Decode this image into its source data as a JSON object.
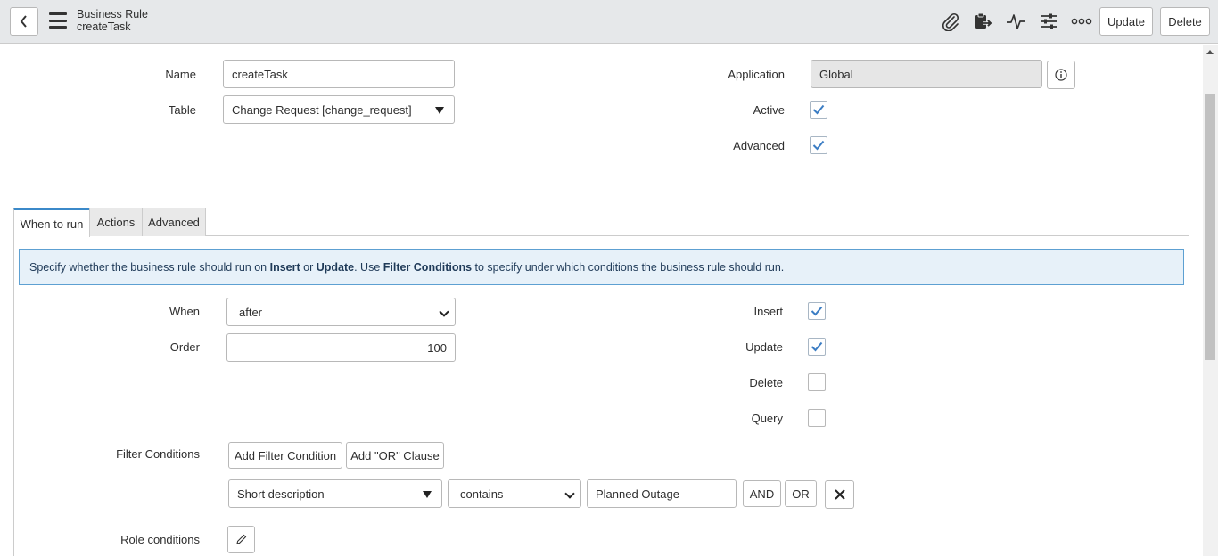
{
  "header": {
    "title": "Business Rule",
    "subtitle": "createTask",
    "icons": [
      "back-icon",
      "hamburger-icon",
      "paperclip-icon",
      "clipboard-export-icon",
      "activity-icon",
      "sliders-icon",
      "more-icon"
    ],
    "update_label": "Update",
    "delete_label": "Delete"
  },
  "form": {
    "name_label": "Name",
    "name_value": "createTask",
    "table_label": "Table",
    "table_value": "Change Request [change_request]",
    "application_label": "Application",
    "application_value": "Global",
    "active_label": "Active",
    "active_checked": true,
    "advanced_label": "Advanced",
    "advanced_checked": true
  },
  "tabs": [
    {
      "label": "When to run",
      "active": true
    },
    {
      "label": "Actions",
      "active": false
    },
    {
      "label": "Advanced",
      "active": false
    }
  ],
  "when_to_run": {
    "banner_parts": [
      "Specify whether the business rule should run on ",
      "Insert",
      " or ",
      "Update",
      ". Use ",
      "Filter Conditions",
      " to specify under which conditions the business rule should run."
    ],
    "when_label": "When",
    "when_value": "after",
    "order_label": "Order",
    "order_value": "100",
    "insert_label": "Insert",
    "insert_checked": true,
    "update_label": "Update",
    "update_checked": true,
    "delete_label": "Delete",
    "delete_checked": false,
    "query_label": "Query",
    "query_checked": false,
    "filter_label": "Filter Conditions",
    "add_filter_label": "Add Filter Condition",
    "add_or_label": "Add \"OR\" Clause",
    "condition": {
      "field": "Short description",
      "operator": "contains",
      "value": "Planned Outage",
      "and_label": "AND",
      "or_label": "OR"
    },
    "role_label": "Role conditions"
  },
  "colors": {
    "header_bg": "#e6e8ea",
    "accent": "#3b89c9",
    "check": "#3b7dc4",
    "banner_bg": "#e7f1f9",
    "banner_border": "#5da0d2"
  }
}
